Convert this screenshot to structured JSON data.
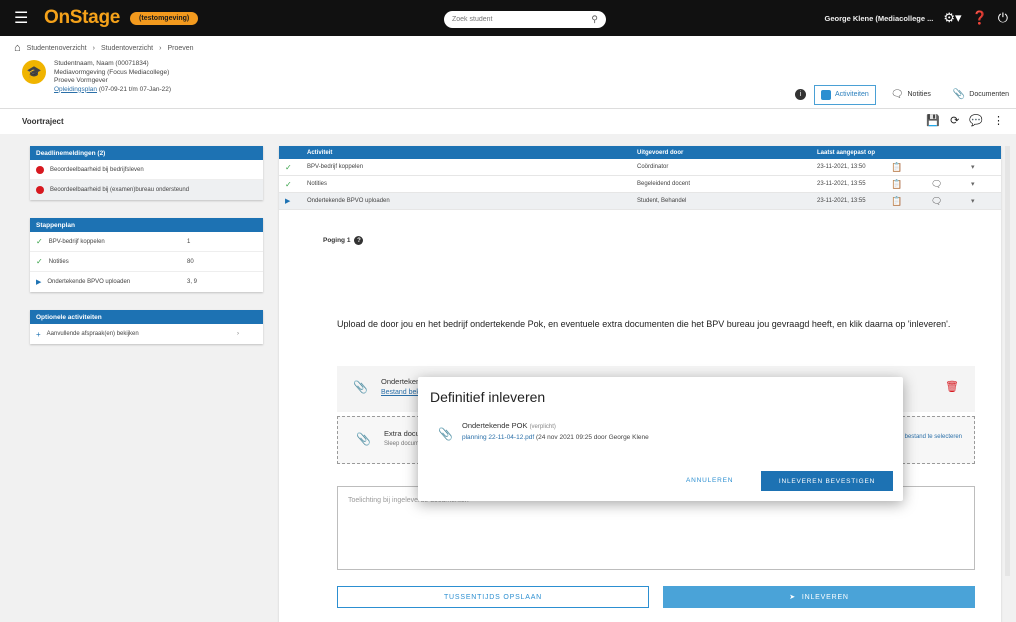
{
  "topbar": {
    "menu_icon": "menu-icon",
    "logo": "OnStage",
    "env_badge": "(testomgeving)",
    "search_placeholder": "Zoek student",
    "user": "George Klene (Mediacollege ...",
    "icons": [
      "search-icon",
      "settings-icon",
      "help-icon",
      "power-icon"
    ]
  },
  "breadcrumb": {
    "items": [
      "Studentenoverzicht",
      "Studentoverzicht",
      "Proeven"
    ]
  },
  "student": {
    "line1": "Studentnaam, Naam (00071834)",
    "line2": "Mediavormgeving (Focus Mediacollege)",
    "line3": "Proeve Vormgever",
    "link": "Opleidingsplan",
    "line4_suffix": " (07-09-21 t/m 07-Jan-22)"
  },
  "view_tabs": {
    "active": "Activiteiten",
    "notes": "Notities",
    "docs": "Documenten"
  },
  "page": {
    "title": "Voortraject"
  },
  "left_cards": {
    "deadlines": {
      "title": "Deadlinemeldingen (2)",
      "items": [
        "Beoordeelbaarheid bij bedrijfsleven",
        "Beoordeelbaarheid bij (examen)bureau ondersteund"
      ]
    },
    "steps": {
      "title": "Stappenplan",
      "items": [
        {
          "label": "BPV-bedrijf koppelen",
          "value": "1"
        },
        {
          "label": "Notities",
          "value": "80"
        },
        {
          "label": "Ondertekende BPVO uploaden",
          "value": "3, 9"
        }
      ]
    },
    "optional": {
      "title": "Optionele activiteiten",
      "items": [
        "Aanvullende afspraak(en) bekijken"
      ]
    }
  },
  "table": {
    "headers": [
      "Activiteit",
      "Uitgevoerd door",
      "Laatst aangepast op"
    ],
    "rows": [
      {
        "status": "check",
        "activity": "BPV-bedrijf koppelen",
        "by": "Coördinator",
        "date": "23-11-2021, 13:50"
      },
      {
        "status": "check",
        "activity": "Notities",
        "by": "Begeleidend docent",
        "date": "23-11-2021, 13:55"
      },
      {
        "status": "current",
        "activity": "Ondertekende BPVO uploaden",
        "by": "Student, Behandel",
        "date": "23-11-2021, 13:55"
      }
    ]
  },
  "pane": {
    "step": "Poging 1",
    "instruction": "Upload de door jou en het bedrijf ondertekende Pok, en eventuele extra documenten die het BPV bureau jou gevraagd heeft, en klik daarna op 'inleveren'.",
    "upload1_name": "Ondertekende POK",
    "upload1_link": "Bestand bekijken",
    "upload2_name": "Extra documenten",
    "upload2_sub": "Sleep documenten hierheen",
    "upload2_right": "of klik om een bestand te selecteren",
    "textarea_placeholder": "Toelichting bij ingeleverde documenten",
    "save_button": "TUSSENTIJDS OPSLAAN",
    "submit_button": "INLEVEREN"
  },
  "modal": {
    "title": "Definitief inleveren",
    "doc_name": "Ondertekende POK",
    "doc_note": "(verplicht)",
    "doc_link": "planning 22-11-04-12.pdf",
    "doc_meta": " (24 nov 2021 09:25 door George Klene",
    "cancel": "ANNULEREN",
    "confirm": "INLEVEREN BEVESTIGEN"
  }
}
